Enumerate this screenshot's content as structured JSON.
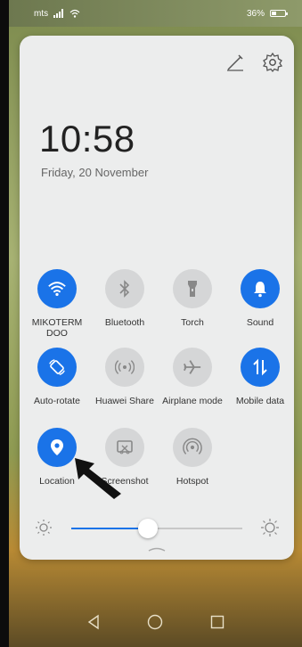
{
  "status": {
    "carrier": "mts",
    "battery": "36%"
  },
  "panel": {
    "time": "10:58",
    "date": "Friday, 20 November"
  },
  "tiles": [
    {
      "label": "MIKOTERM DOO",
      "icon": "wifi-icon",
      "on": true
    },
    {
      "label": "Bluetooth",
      "icon": "bluetooth-icon",
      "on": false
    },
    {
      "label": "Torch",
      "icon": "torch-icon",
      "on": false
    },
    {
      "label": "Sound",
      "icon": "bell-icon",
      "on": true
    },
    {
      "label": "Auto-rotate",
      "icon": "rotate-icon",
      "on": true
    },
    {
      "label": "Huawei Share",
      "icon": "share-icon",
      "on": false
    },
    {
      "label": "Airplane mode",
      "icon": "airplane-icon",
      "on": false
    },
    {
      "label": "Mobile data",
      "icon": "mobile-data-icon",
      "on": true
    },
    {
      "label": "Location",
      "icon": "location-icon",
      "on": true
    },
    {
      "label": "Screenshot",
      "icon": "screenshot-icon",
      "on": false
    },
    {
      "label": "Hotspot",
      "icon": "hotspot-icon",
      "on": false
    }
  ],
  "brightness": {
    "level": 0.45
  },
  "colors": {
    "accent": "#1a73e8",
    "tile_off": "#d5d6d7",
    "panel_bg": "#eceded"
  }
}
